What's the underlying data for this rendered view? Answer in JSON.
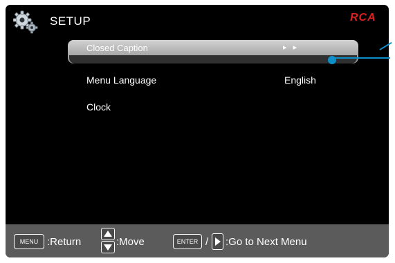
{
  "header": {
    "title": "SETUP",
    "brand": "RCA",
    "icon": "gear-icon"
  },
  "menu": {
    "items": [
      {
        "label": "Closed Caption",
        "value": "▸ ▸",
        "selected": true
      },
      {
        "label": "Menu Language",
        "value": "English",
        "selected": false
      },
      {
        "label": "Clock",
        "value": "",
        "selected": false
      }
    ]
  },
  "footer": {
    "menu_key": "MENU",
    "return_label": ":Return",
    "move_label": ":Move",
    "enter_key": "ENTER",
    "slash": "/",
    "next_label": ":Go to Next Menu"
  },
  "colors": {
    "screen_background": "#000000",
    "footer_background": "#5b5b5b",
    "callout": "#0f8fc8",
    "brand": "#e02020"
  }
}
